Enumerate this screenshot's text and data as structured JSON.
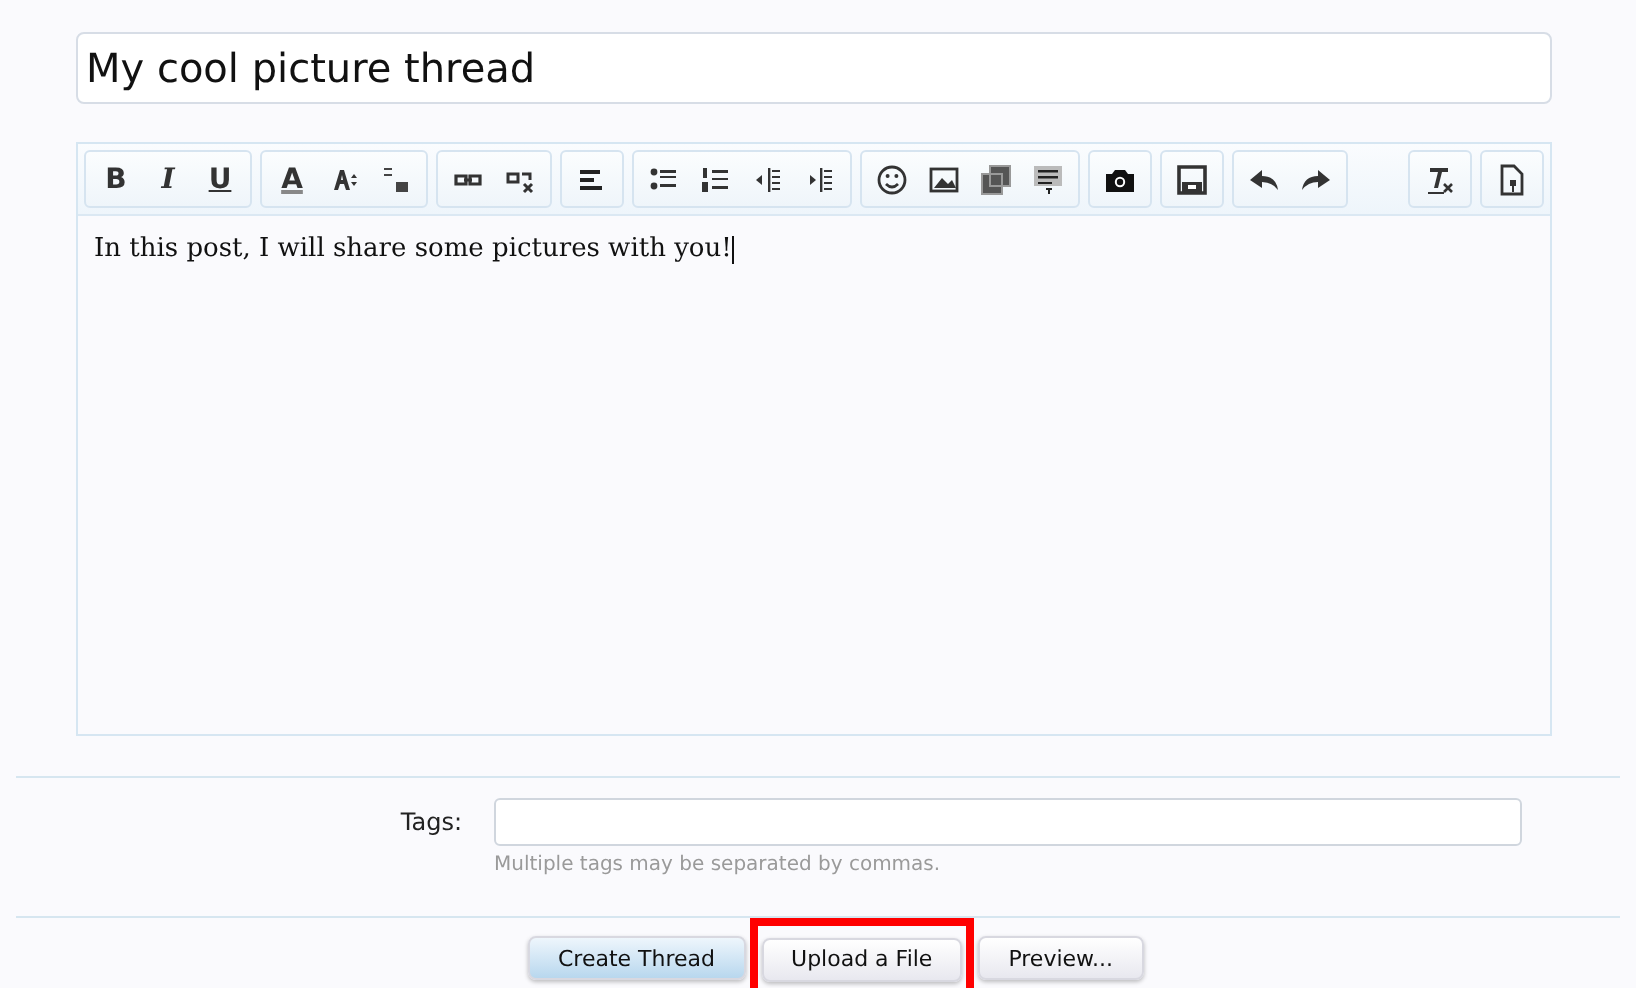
{
  "title_field": {
    "value": "My cool picture thread"
  },
  "toolbar": {
    "groups": [
      [
        {
          "kind": "text",
          "label": "B"
        },
        {
          "kind": "text",
          "label": "I"
        },
        {
          "kind": "text",
          "label": "U"
        }
      ],
      [
        {
          "kind": "text",
          "label": "A"
        },
        {
          "kind": "icon"
        },
        {
          "kind": "icon"
        }
      ],
      [
        {
          "kind": "icon"
        },
        {
          "kind": "icon"
        }
      ],
      [
        {
          "kind": "icon"
        }
      ],
      [
        {
          "kind": "icon"
        },
        {
          "kind": "icon"
        },
        {
          "kind": "icon"
        },
        {
          "kind": "icon"
        }
      ],
      [
        {
          "kind": "icon"
        },
        {
          "kind": "icon"
        },
        {
          "kind": "icon"
        },
        {
          "kind": "icon"
        }
      ],
      [
        {
          "kind": "icon"
        }
      ],
      [
        {
          "kind": "icon"
        }
      ],
      [
        {
          "kind": "icon"
        },
        {
          "kind": "icon"
        }
      ],
      [
        {
          "kind": "icon"
        }
      ],
      [
        {
          "kind": "icon"
        }
      ]
    ]
  },
  "editor": {
    "value": "In this post, I will share some pictures with you!"
  },
  "tags": {
    "label": "Tags:",
    "hint": "Multiple tags may be separated by commas."
  },
  "buttons": [
    {
      "label": "Create Thread",
      "primary": true,
      "highlighted": false
    },
    {
      "label": "Upload a File",
      "primary": false,
      "highlighted": true
    },
    {
      "label": "Preview...",
      "primary": false,
      "highlighted": false
    }
  ]
}
